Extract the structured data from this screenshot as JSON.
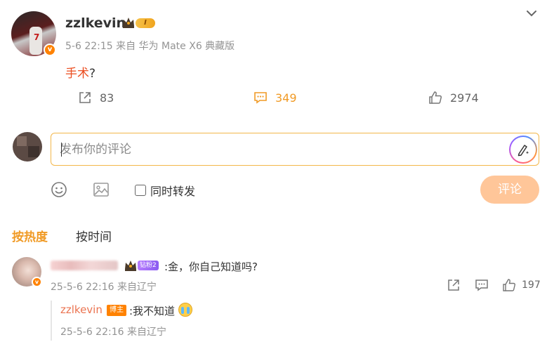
{
  "post": {
    "avatar_number": "7",
    "username": "zzlkevin",
    "level": "I",
    "meta": "5-6 22:15 来自 华为 Mate X6 典藏版",
    "text_highlight": "手术",
    "text_rest": "?",
    "actions": {
      "shares": "83",
      "comments": "349",
      "likes": "2974"
    }
  },
  "composer": {
    "placeholder": "发布你的评论",
    "repost_label": "同时转发",
    "submit_label": "评论"
  },
  "sort": {
    "hot": "按热度",
    "time": "按时间"
  },
  "comments": [
    {
      "fan_badge": "钻粉2",
      "text": ":金，你自己知道吗?",
      "meta": "25-5-6 22:16 来自辽宁",
      "likes": "197",
      "reply": {
        "username": "zzlkevin",
        "tag": "博主",
        "text": ":我不知道",
        "meta": "25-5-6 22:16 来自辽宁"
      }
    }
  ],
  "colors": {
    "accent": "#f09a25",
    "link": "#eb7350",
    "highlight": "#eb4d1f",
    "composer_border": "#f3b74a",
    "submit_bg": "#ffc699"
  }
}
